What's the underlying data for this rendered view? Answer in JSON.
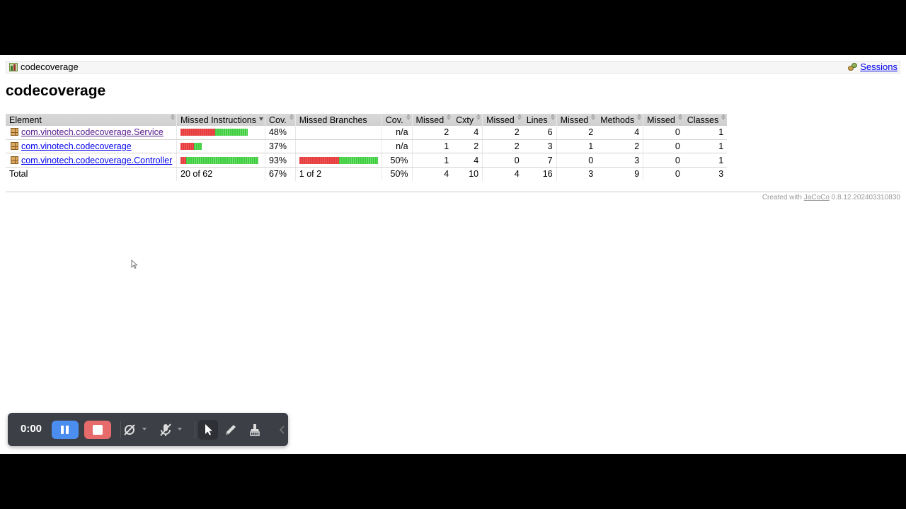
{
  "breadcrumb": {
    "report_name": "codecoverage",
    "sessions_label": "Sessions"
  },
  "page_title": "codecoverage",
  "table": {
    "headers": [
      "Element",
      "Missed Instructions",
      "Cov.",
      "Missed Branches",
      "Cov.",
      "Missed",
      "Cxty",
      "Missed",
      "Lines",
      "Missed",
      "Methods",
      "Missed",
      "Classes"
    ],
    "rows": [
      {
        "element": "com.vinotech.codecoverage.Service",
        "instr_missed_frac": 0.52,
        "instr_cov": "48%",
        "branch_missed_frac": null,
        "branch_cov": "n/a",
        "cxty_missed": "2",
        "cxty": "4",
        "lines_missed": "2",
        "lines": "6",
        "methods_missed": "2",
        "methods": "4",
        "classes_missed": "0",
        "classes": "1",
        "visited": true
      },
      {
        "element": "com.vinotech.codecoverage",
        "instr_missed_frac": 0.63,
        "instr_cov": "37%",
        "branch_missed_frac": null,
        "branch_cov": "n/a",
        "cxty_missed": "1",
        "cxty": "2",
        "lines_missed": "2",
        "lines": "3",
        "methods_missed": "1",
        "methods": "2",
        "classes_missed": "0",
        "classes": "1",
        "visited": false
      },
      {
        "element": "com.vinotech.codecoverage.Controller",
        "instr_missed_frac": 0.07,
        "instr_cov": "93%",
        "branch_missed_frac": 0.5,
        "branch_cov": "50%",
        "cxty_missed": "1",
        "cxty": "4",
        "lines_missed": "0",
        "lines": "7",
        "methods_missed": "0",
        "methods": "3",
        "classes_missed": "0",
        "classes": "1",
        "visited": false
      }
    ],
    "total": {
      "label": "Total",
      "instr": "20 of 62",
      "instr_cov": "67%",
      "branch": "1 of 2",
      "branch_cov": "50%",
      "cxty_missed": "4",
      "cxty": "10",
      "lines_missed": "4",
      "lines": "16",
      "methods_missed": "3",
      "methods": "9",
      "classes_missed": "0",
      "classes": "3"
    }
  },
  "footer": {
    "prefix": "Created with",
    "tool_link": "JaCoCo",
    "version": "0.8.12.202403310830"
  },
  "recorder": {
    "timer": "0:00",
    "icons": [
      "pause-icon",
      "stop-icon",
      "camera-off-icon",
      "mic-off-icon",
      "pointer-icon",
      "pen-icon",
      "eraser-icon",
      "collapse-icon"
    ]
  },
  "colors": {
    "missed": "#e53d3d",
    "covered": "#3fce3f",
    "header_bg": "#d4d4d4",
    "pause": "#4b8ef0",
    "stop": "#e76b6b"
  }
}
